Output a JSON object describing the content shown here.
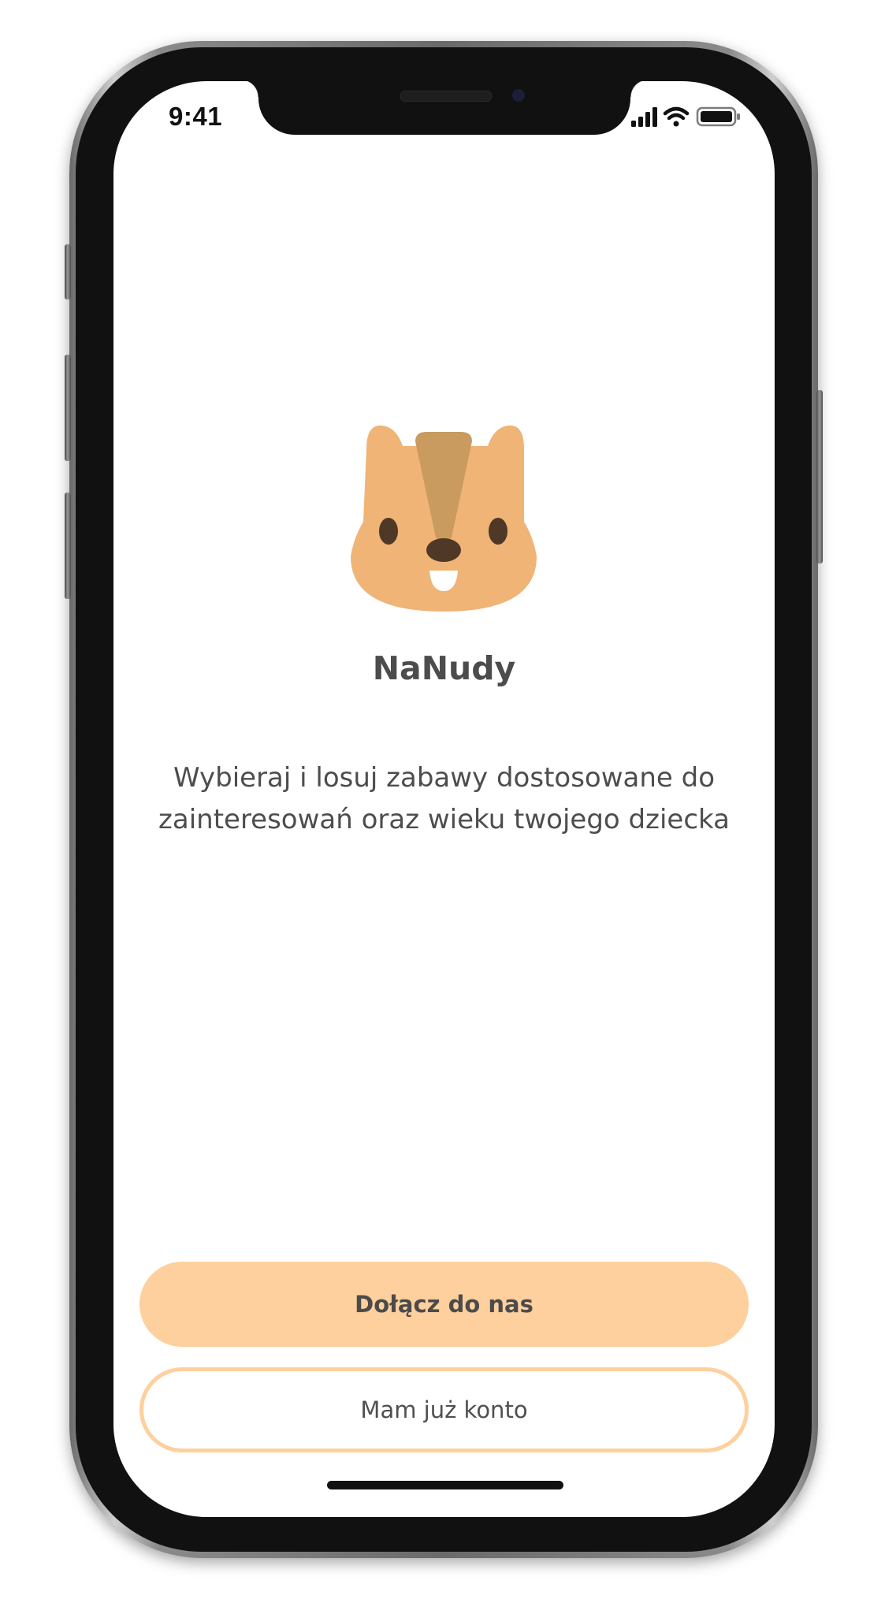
{
  "status_bar": {
    "time": "9:41",
    "icons": [
      "cellular-signal-icon",
      "wifi-icon",
      "battery-icon"
    ]
  },
  "app": {
    "name": "NaNudy",
    "logo_icon": "squirrel-icon",
    "tagline_line1": "Wybieraj i losuj zabawy dostosowane do",
    "tagline_line2": "zainteresowań oraz wieku twojego dziecka"
  },
  "actions": {
    "join_label": "Dołącz do nas",
    "login_label": "Mam już konto"
  },
  "colors": {
    "accent": "#fdd09d",
    "squirrel_face": "#efb476",
    "squirrel_stripe": "#c99b5e",
    "squirrel_features": "#4f3826",
    "text": "#4c4c4c"
  }
}
